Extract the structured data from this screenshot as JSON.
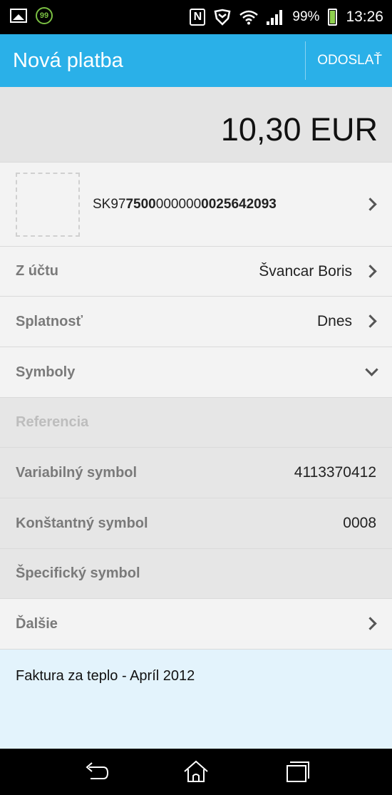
{
  "status_bar": {
    "notification_badge": "99",
    "nfc_glyph": "N",
    "battery": "99%",
    "time": "13:26"
  },
  "action_bar": {
    "title": "Nová platba",
    "send_label": "ODOSLAŤ"
  },
  "payment": {
    "amount": "10,30 EUR",
    "iban_parts": [
      {
        "text": "SK97",
        "bold": false
      },
      {
        "text": "7500",
        "bold": true
      },
      {
        "text": "000000",
        "bold": false
      },
      {
        "text": "0025642093",
        "bold": true
      }
    ]
  },
  "rows": {
    "from_account": {
      "label": "Z účtu",
      "value": "Švancar Boris"
    },
    "due_date": {
      "label": "Splatnosť",
      "value": "Dnes"
    },
    "symbols": {
      "label": "Symboly"
    },
    "reference": {
      "label": "Referencia"
    },
    "variable_symbol": {
      "label": "Variabilný symbol",
      "value": "4113370412"
    },
    "constant_symbol": {
      "label": "Konštantný symbol",
      "value": "0008"
    },
    "specific_symbol": {
      "label": "Špecifický symbol"
    },
    "more": {
      "label": "Ďalšie"
    }
  },
  "note": {
    "text": "Faktura za teplo - Apríl 2012"
  },
  "colors": {
    "action_bar": "#2ab0e8",
    "note_background": "#e3f3fc",
    "battery": "#8fd14f"
  }
}
